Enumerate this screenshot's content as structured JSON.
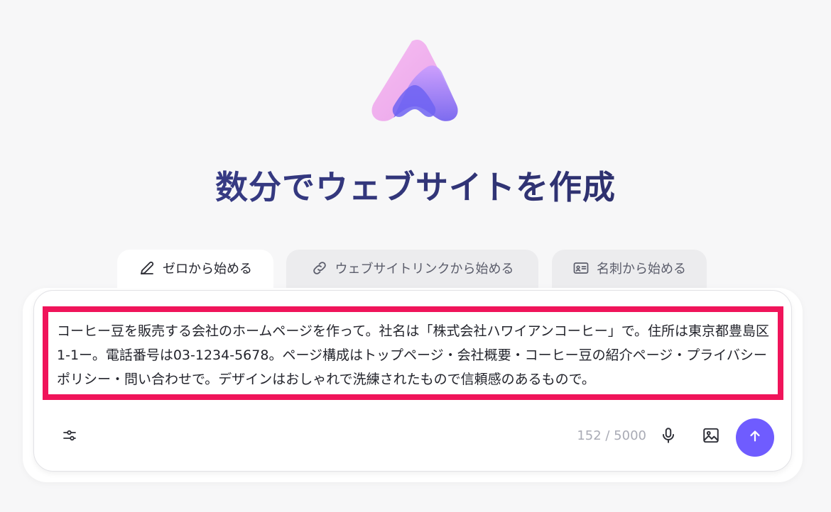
{
  "header": {
    "title": "数分でウェブサイトを作成"
  },
  "tabs": [
    {
      "label": "ゼロから始める",
      "icon": "pencil-icon",
      "active": true
    },
    {
      "label": "ウェブサイトリンクから始める",
      "icon": "link-icon",
      "active": false
    },
    {
      "label": "名刺から始める",
      "icon": "id-card-icon",
      "active": false
    }
  ],
  "prompt": {
    "value": "コーヒー豆を販売する会社のホームページを作って。社名は「株式会社ハワイアンコーヒー」で。住所は東京都豊島区1-1ー。電話番号は03-1234-5678。ページ構成はトップページ・会社概要・コーヒー豆の紹介ページ・プライバシーポリシー・問い合わせで。デザインはおしゃれで洗練されたもので信頼感のあるもので。",
    "highlight_color": "#f0145a"
  },
  "toolbar": {
    "settings_icon": "sliders-icon",
    "counter": "152 / 5000",
    "mic_icon": "microphone-icon",
    "image_icon": "image-icon",
    "send_icon": "arrow-up-icon",
    "send_color": "#6f5cff"
  }
}
